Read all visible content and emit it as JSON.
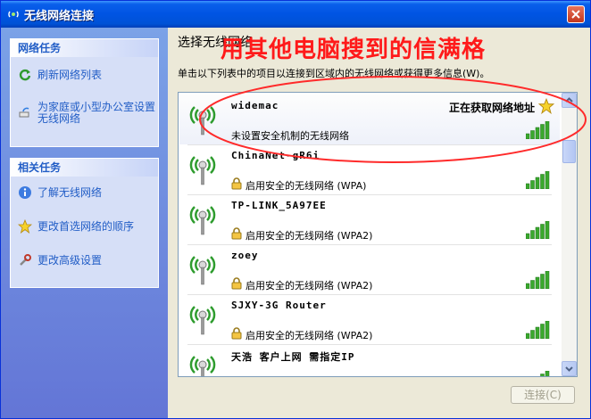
{
  "window": {
    "title": "无线网络连接",
    "icons": {
      "app": "wireless-network-icon",
      "close": "close-icon"
    }
  },
  "network_tasks": {
    "header": "网络任务",
    "items": [
      {
        "label": "刷新网络列表",
        "icon": "refresh-icon"
      },
      {
        "label": "为家庭或小型办公室设置无线网络",
        "icon": "setup-network-icon"
      }
    ]
  },
  "related_tasks": {
    "header": "相关任务",
    "items": [
      {
        "label": "了解无线网络",
        "icon": "info-icon"
      },
      {
        "label": "更改首选网络的顺序",
        "icon": "star-icon"
      },
      {
        "label": "更改高级设置",
        "icon": "tools-icon"
      }
    ]
  },
  "main": {
    "title": "选择无线网络",
    "overlay_text": "用其他电脑搜到的信满格",
    "instructions": "单击以下列表中的项目以连接到区域内的无线网络或获得更多信息(W)。"
  },
  "networks": [
    {
      "ssid": "widemac",
      "status": "正在获取网络地址",
      "security": "未设置安全机制的无线网络",
      "secured": false,
      "signal_bars": 5,
      "selected": true,
      "preferred": true
    },
    {
      "ssid": "ChinaNet-gR6i",
      "status": "",
      "security": "启用安全的无线网络 (WPA)",
      "secured": true,
      "signal_bars": 5,
      "selected": false,
      "preferred": false
    },
    {
      "ssid": "TP-LINK_5A97EE",
      "status": "",
      "security": "启用安全的无线网络 (WPA2)",
      "secured": true,
      "signal_bars": 5,
      "selected": false,
      "preferred": false
    },
    {
      "ssid": "zoey",
      "status": "",
      "security": "启用安全的无线网络 (WPA2)",
      "secured": true,
      "signal_bars": 5,
      "selected": false,
      "preferred": false
    },
    {
      "ssid": "SJXY-3G Router",
      "status": "",
      "security": "启用安全的无线网络 (WPA2)",
      "secured": true,
      "signal_bars": 5,
      "selected": false,
      "preferred": false
    },
    {
      "ssid": "天浩 客户上网 需指定IP",
      "status": "",
      "security": "",
      "secured": false,
      "signal_bars": 5,
      "selected": false,
      "preferred": false
    }
  ],
  "connect_button": "连接(C)",
  "colors": {
    "title_bar": "#0054e3",
    "task_pane": "#6f8edc",
    "task_link": "#215dc6",
    "overlay_red": "#ff1a1a",
    "signal_green": "#3aa82d"
  }
}
